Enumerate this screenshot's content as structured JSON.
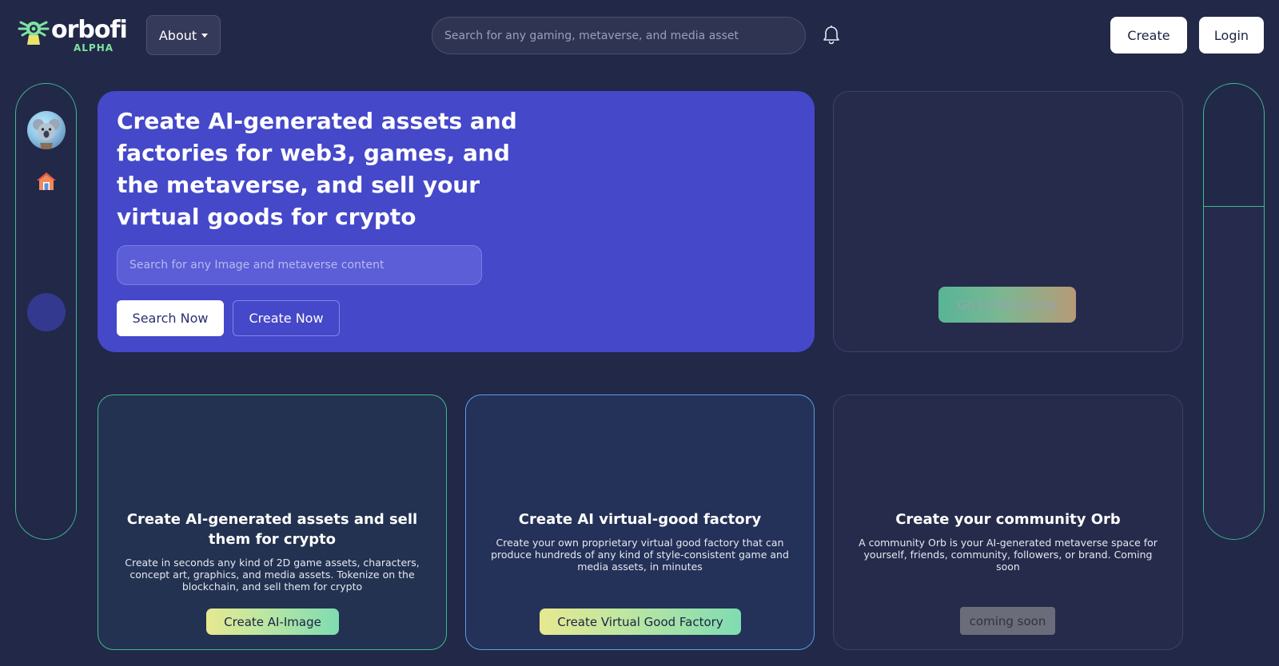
{
  "header": {
    "logo_word": "orbofi",
    "logo_sub": "ALPHA",
    "about_label": "About",
    "search_placeholder": "Search for any gaming, metaverse, and media asset",
    "create_label": "Create",
    "login_label": "Login"
  },
  "hero": {
    "title": "Create AI-generated assets and factories for web3, games, and the metaverse, and sell your virtual goods for crypto",
    "search_placeholder": "Search for any Image and metaverse content",
    "search_button": "Search Now",
    "create_button": "Create Now"
  },
  "metaverse_card": {
    "button": "Go to Metaverse"
  },
  "cards": [
    {
      "title": "Create AI-generated assets and sell them for crypto",
      "description": "Create in seconds any kind of 2D game assets, characters, concept art, graphics, and media assets. Tokenize on the blockchain, and sell them for crypto",
      "button": "Create AI-Image"
    },
    {
      "title": "Create AI virtual-good factory",
      "description": "Create your own proprietary virtual good factory that can produce hundreds of any kind of style-consistent game and media assets, in minutes",
      "button": "Create Virtual Good Factory"
    },
    {
      "title": "Create your community Orb",
      "description": "A community Orb is your AI-generated metaverse space for yourself, friends, community, followers, or brand. Coming soon",
      "button": "coming soon"
    }
  ]
}
